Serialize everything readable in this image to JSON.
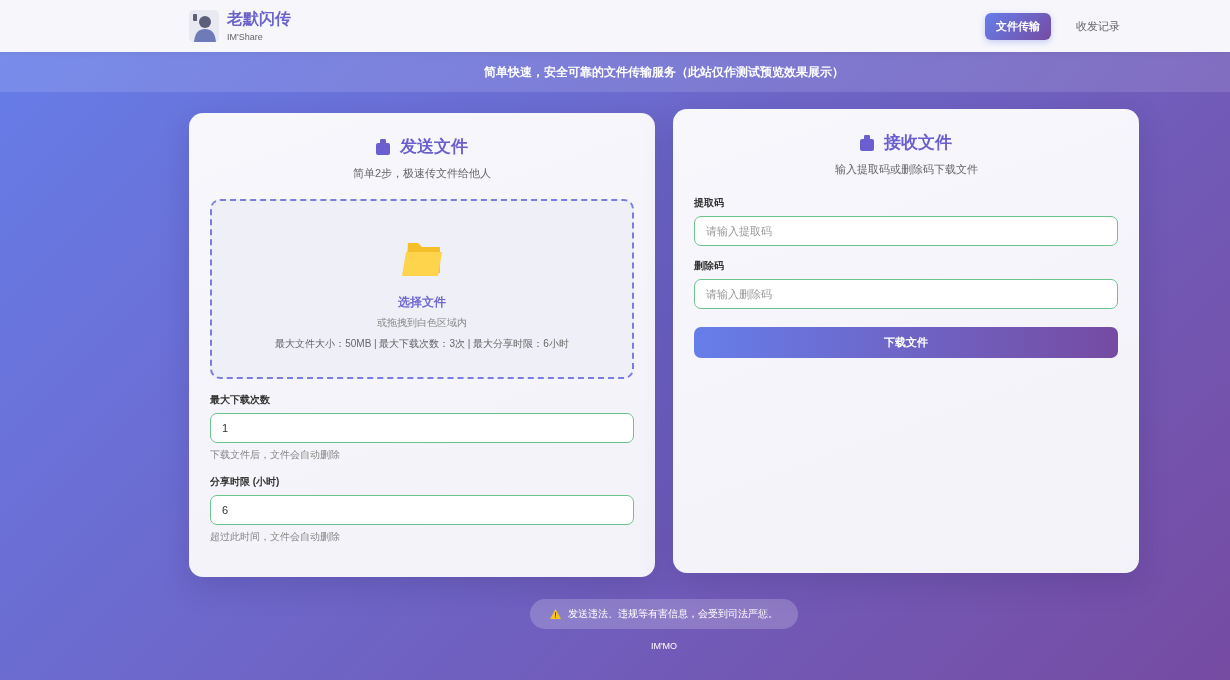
{
  "header": {
    "brand": {
      "title": "老默闪传",
      "subtitle": "IM'Share"
    },
    "nav": [
      {
        "label": "文件传输",
        "selected": true
      },
      {
        "label": "收发记录",
        "selected": false
      }
    ]
  },
  "banner": "简单快速，安全可靠的文件传输服务（此站仅作测试预览效果展示）",
  "send_panel": {
    "title": "发送文件",
    "subtitle": "简单2步，极速传文件给他人",
    "dropzone": {
      "action": "选择文件",
      "hint": "或拖拽到白色区域内",
      "limits": "最大文件大小：50MB | 最大下载次数：3次 | 最大分享时限：6小时"
    },
    "fields": [
      {
        "label": "最大下载次数",
        "value": "1",
        "hint": "下载文件后，文件会自动删除"
      },
      {
        "label": "分享时限 (小时)",
        "value": "6",
        "hint": "超过此时间，文件会自动删除"
      }
    ]
  },
  "receive_panel": {
    "title": "接收文件",
    "subtitle": "输入提取码或删除码下载文件",
    "fields": [
      {
        "label": "提取码",
        "placeholder": "请输入提取码"
      },
      {
        "label": "删除码",
        "placeholder": "请输入删除码"
      }
    ],
    "button": "下载文件"
  },
  "notice": "发送违法、违规等有害信息，会受到司法严惩。",
  "footer": "IM'MO"
}
